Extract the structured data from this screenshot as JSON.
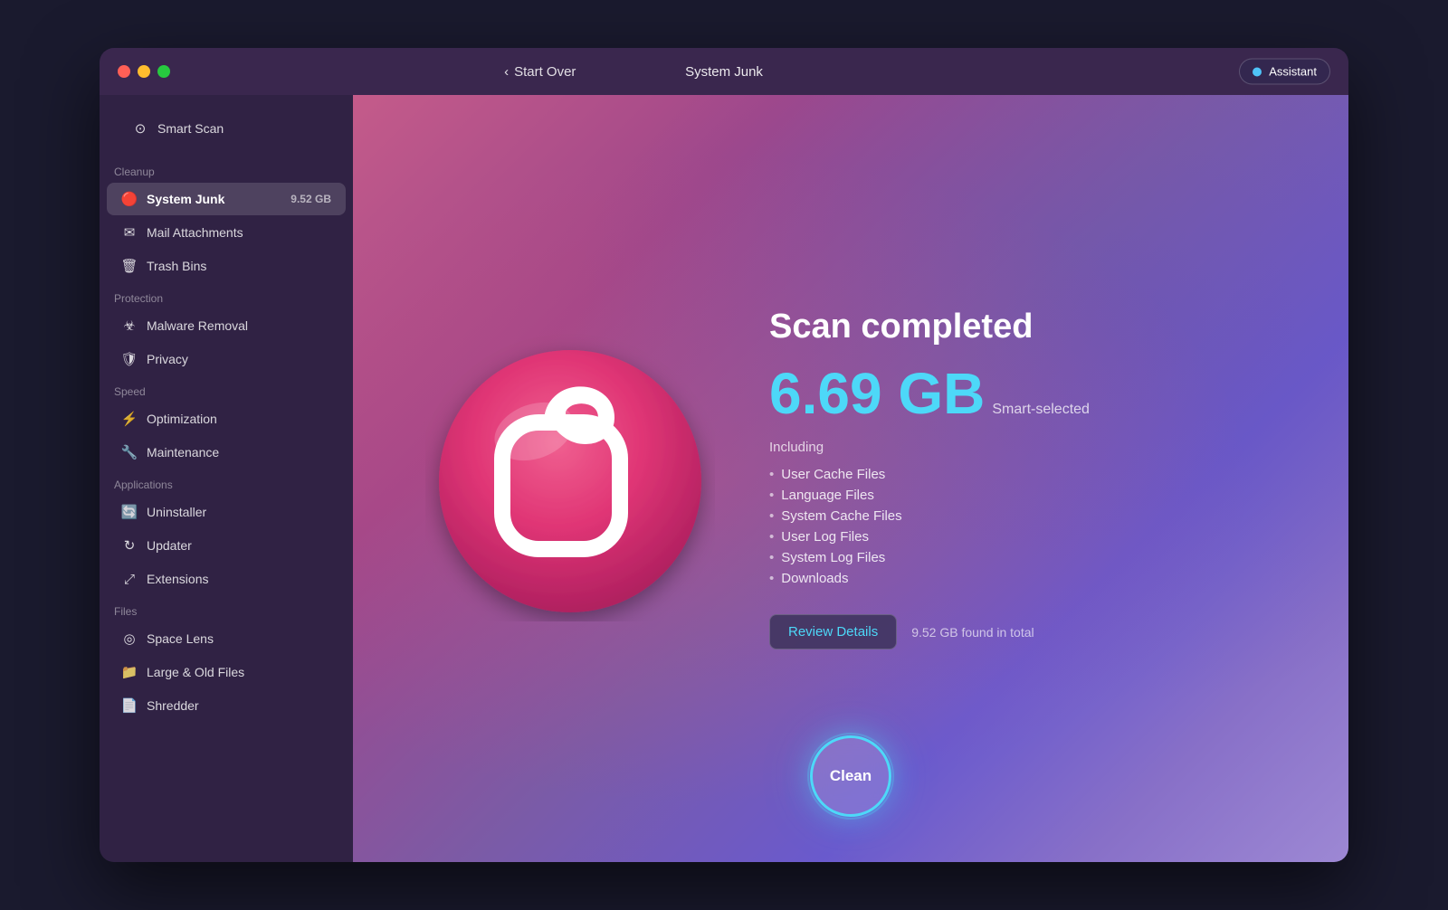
{
  "window": {
    "title": "System Junk",
    "back_label": "Start Over",
    "assistant_label": "Assistant"
  },
  "sidebar": {
    "smart_scan_label": "Smart Scan",
    "sections": [
      {
        "label": "Cleanup",
        "items": [
          {
            "id": "system-junk",
            "label": "System Junk",
            "badge": "9.52 GB",
            "active": true,
            "icon": "🔴"
          },
          {
            "id": "mail-attachments",
            "label": "Mail Attachments",
            "badge": "",
            "active": false,
            "icon": "✉"
          },
          {
            "id": "trash-bins",
            "label": "Trash Bins",
            "badge": "",
            "active": false,
            "icon": "🗑"
          }
        ]
      },
      {
        "label": "Protection",
        "items": [
          {
            "id": "malware-removal",
            "label": "Malware Removal",
            "badge": "",
            "active": false,
            "icon": "☣"
          },
          {
            "id": "privacy",
            "label": "Privacy",
            "badge": "",
            "active": false,
            "icon": "🛡"
          }
        ]
      },
      {
        "label": "Speed",
        "items": [
          {
            "id": "optimization",
            "label": "Optimization",
            "badge": "",
            "active": false,
            "icon": "⚡"
          },
          {
            "id": "maintenance",
            "label": "Maintenance",
            "badge": "",
            "active": false,
            "icon": "🔧"
          }
        ]
      },
      {
        "label": "Applications",
        "items": [
          {
            "id": "uninstaller",
            "label": "Uninstaller",
            "badge": "",
            "active": false,
            "icon": "🔄"
          },
          {
            "id": "updater",
            "label": "Updater",
            "badge": "",
            "active": false,
            "icon": "↻"
          },
          {
            "id": "extensions",
            "label": "Extensions",
            "badge": "",
            "active": false,
            "icon": "⤢"
          }
        ]
      },
      {
        "label": "Files",
        "items": [
          {
            "id": "space-lens",
            "label": "Space Lens",
            "badge": "",
            "active": false,
            "icon": "◎"
          },
          {
            "id": "large-old-files",
            "label": "Large & Old Files",
            "badge": "",
            "active": false,
            "icon": "📁"
          },
          {
            "id": "shredder",
            "label": "Shredder",
            "badge": "",
            "active": false,
            "icon": "📄"
          }
        ]
      }
    ]
  },
  "main": {
    "scan_completed_label": "Scan completed",
    "size_value": "6.69 GB",
    "smart_selected_label": "Smart-selected",
    "including_label": "Including",
    "file_items": [
      "User Cache Files",
      "Language Files",
      "System Cache Files",
      "User Log Files",
      "System Log Files",
      "Downloads"
    ],
    "review_details_label": "Review Details",
    "found_total_label": "9.52 GB found in total",
    "clean_button_label": "Clean"
  },
  "colors": {
    "accent_blue": "#4dd8f8",
    "active_sidebar": "rgba(255,255,255,0.15)"
  }
}
